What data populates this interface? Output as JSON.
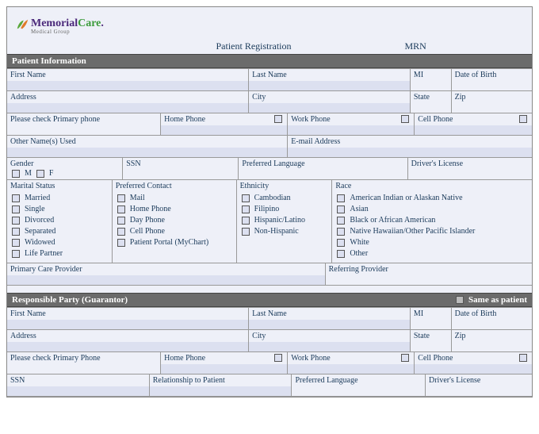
{
  "logo": {
    "brand1": "Memorial",
    "brand2": "Care",
    "suffix": ".",
    "sub": "Medical Group"
  },
  "header": {
    "title": "Patient Registration",
    "mrn_label": "MRN"
  },
  "patient_info": {
    "section_title": "Patient Information",
    "first_name": "First Name",
    "last_name": "Last Name",
    "mi": "MI",
    "dob": "Date of Birth",
    "address": "Address",
    "city": "City",
    "state": "State",
    "zip": "Zip",
    "primary_phone_label": "Please check Primary phone",
    "home_phone": "Home Phone",
    "work_phone": "Work Phone",
    "cell_phone": "Cell Phone",
    "other_names": "Other Name(s) Used",
    "email": "E-mail Address",
    "gender": "Gender",
    "gender_m": "M",
    "gender_f": "F",
    "ssn": "SSN",
    "preferred_language": "Preferred Language",
    "drivers_license": "Driver's License",
    "marital_status": {
      "title": "Marital Status",
      "options": [
        "Married",
        "Single",
        "Divorced",
        "Separated",
        "Widowed",
        "Life Partner"
      ]
    },
    "preferred_contact": {
      "title": "Preferred Contact",
      "options": [
        "Mail",
        "Home Phone",
        "Day Phone",
        "Cell Phone",
        "Patient Portal (MyChart)"
      ]
    },
    "ethnicity": {
      "title": "Ethnicity",
      "options": [
        "Cambodian",
        "Filipino",
        "Hispanic/Latino",
        "Non-Hispanic"
      ]
    },
    "race": {
      "title": "Race",
      "options": [
        "American Indian or Alaskan Native",
        "Asian",
        "Black or African American",
        "Native Hawaiian/Other Pacific Islander",
        "White",
        "Other"
      ]
    },
    "pcp": "Primary Care Provider",
    "referring": "Referring Provider"
  },
  "guarantor": {
    "section_title": "Responsible Party (Guarantor)",
    "same_as_patient": "Same as patient",
    "first_name": "First Name",
    "last_name": "Last Name",
    "mi": "MI",
    "dob": "Date of Birth",
    "address": "Address",
    "city": "City",
    "state": "State",
    "zip": "Zip",
    "primary_phone_label": "Please check Primary Phone",
    "home_phone": "Home Phone",
    "work_phone": "Work Phone",
    "cell_phone": "Cell Phone",
    "ssn": "SSN",
    "relationship": "Relationship to Patient",
    "preferred_language": "Preferred Language",
    "drivers_license": "Driver's License"
  }
}
